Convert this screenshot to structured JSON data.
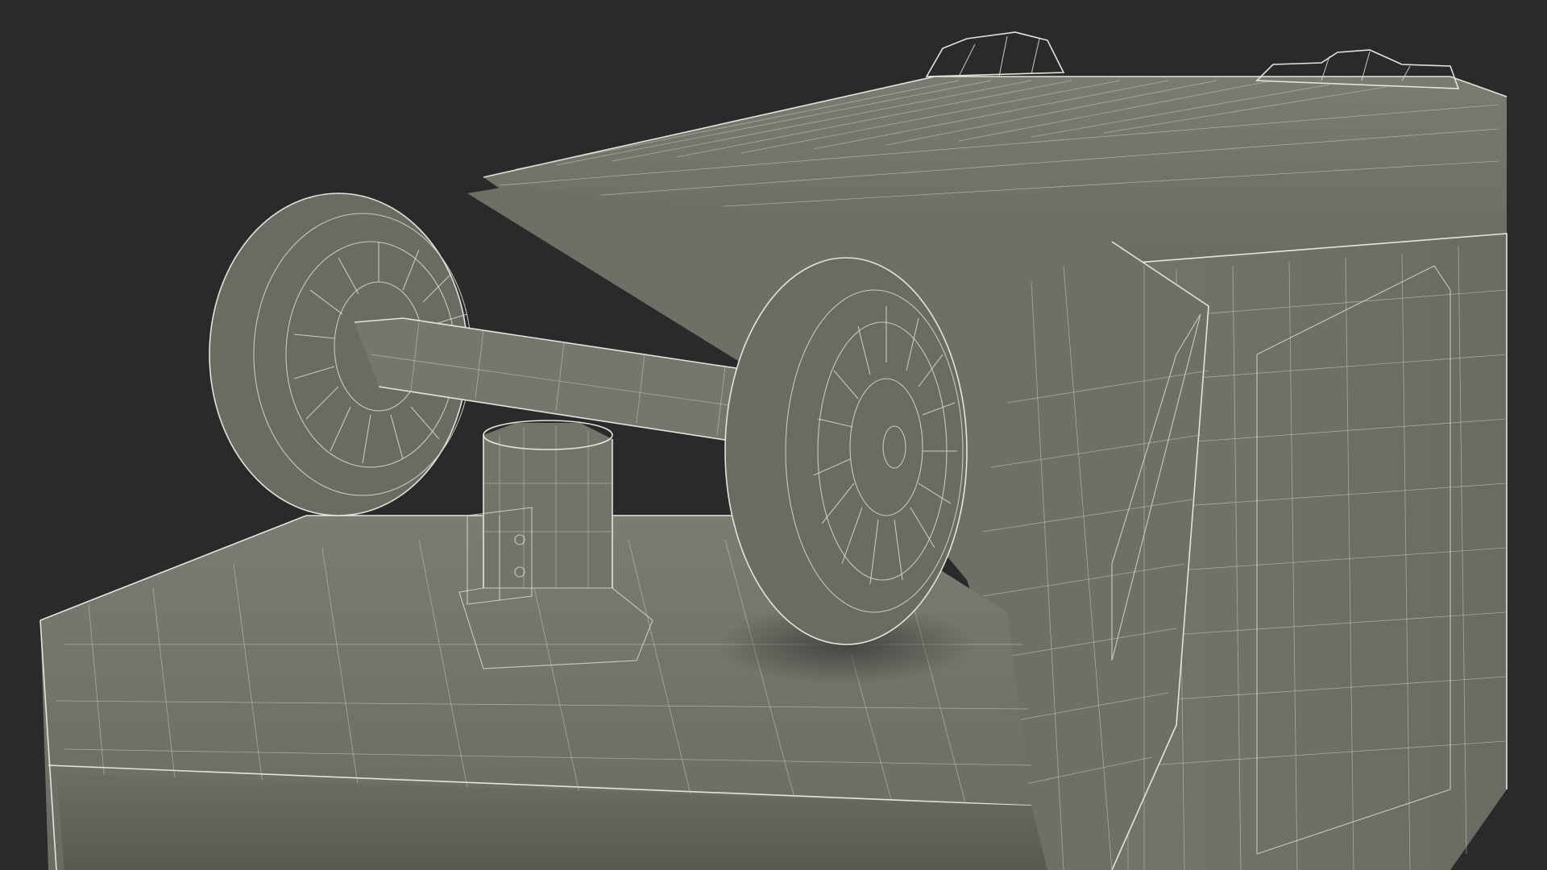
{
  "scene": {
    "background_color": "#2a2a2a",
    "model_color": "#6f7068",
    "wire_color": "#d8d8cf",
    "subject": "wireframe-box-with-wheels"
  }
}
